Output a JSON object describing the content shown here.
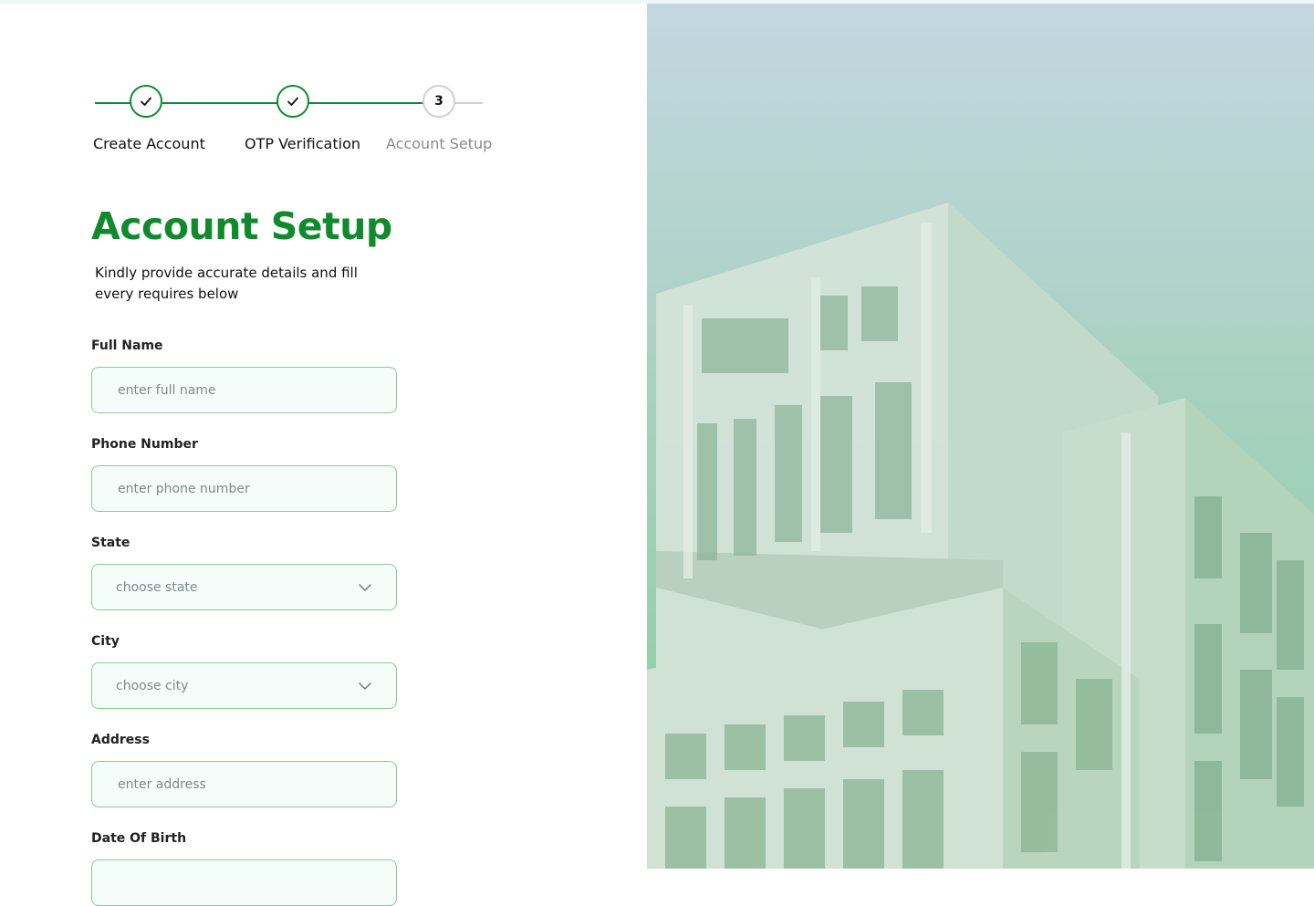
{
  "stepper": {
    "steps": [
      {
        "label": "Create Account",
        "state": "done"
      },
      {
        "label": "OTP Verification",
        "state": "done"
      },
      {
        "label": "Account Setup",
        "state": "current",
        "number": "3"
      }
    ]
  },
  "form": {
    "title": "Account Setup",
    "subtitle": "Kindly provide accurate details and fill every requires below",
    "fields": [
      {
        "label": "Full Name",
        "placeholder": "enter full name",
        "type": "text"
      },
      {
        "label": "Phone Number",
        "placeholder": "enter phone number",
        "type": "text"
      },
      {
        "label": "State",
        "placeholder": "choose state",
        "type": "select"
      },
      {
        "label": "City",
        "placeholder": "choose city",
        "type": "select"
      },
      {
        "label": "Address",
        "placeholder": "enter address",
        "type": "text"
      },
      {
        "label": "Date Of Birth",
        "placeholder": "",
        "type": "text"
      }
    ]
  },
  "colors": {
    "accent": "#118a2d",
    "field_border": "#8cc99b",
    "field_bg": "#f5fdfb"
  },
  "icons": {
    "step_done": "check-icon",
    "select": "chevron-down-icon",
    "hero": "building-image"
  }
}
